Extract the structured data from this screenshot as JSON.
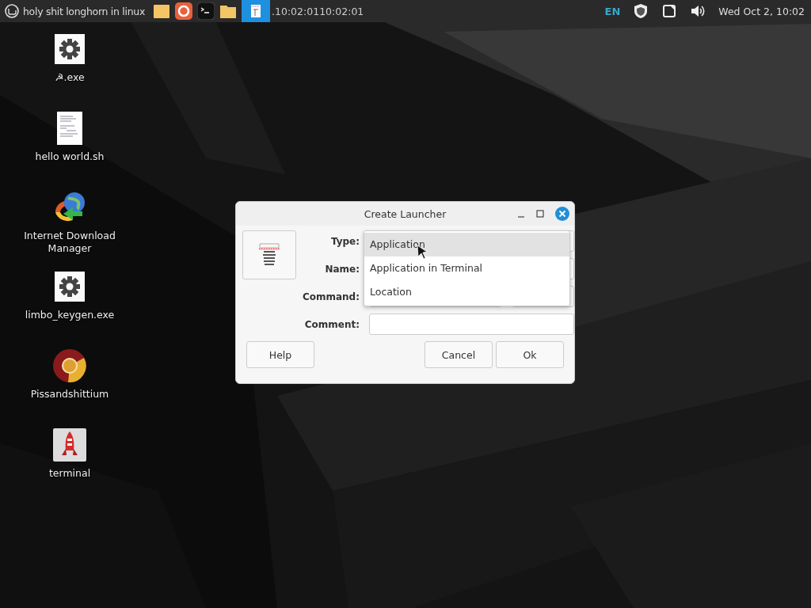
{
  "panel": {
    "menu_label": "holy shit longhorn in linux",
    "window_buttons": [
      {
        "title": ".10:02:0110:02:01",
        "selected": true
      }
    ],
    "keyboard_layout": "EN",
    "clock": "Wed Oct  2, 10:02"
  },
  "desktop_icons": [
    {
      "label": "☭.exe",
      "kind": "gear"
    },
    {
      "label": "hello world.sh",
      "kind": "document"
    },
    {
      "label": "Internet Download Manager",
      "kind": "globe"
    },
    {
      "label": "limbo_keygen.exe",
      "kind": "gear"
    },
    {
      "label": "Pissandshittium",
      "kind": "browser"
    },
    {
      "label": "terminal",
      "kind": "rocket"
    }
  ],
  "dialog": {
    "title": "Create Launcher",
    "labels": [
      "Type:",
      "Name:",
      "Command:",
      "Comment:"
    ],
    "type_options": [
      {
        "label": "Application",
        "selected": true
      },
      {
        "label": "Application in Terminal",
        "selected": false
      },
      {
        "label": "Location",
        "selected": false
      }
    ],
    "buttons": [
      {
        "label": "Help",
        "kind": "left"
      },
      {
        "label": "Cancel",
        "kind": "right"
      },
      {
        "label": "Ok",
        "kind": "right"
      }
    ]
  }
}
